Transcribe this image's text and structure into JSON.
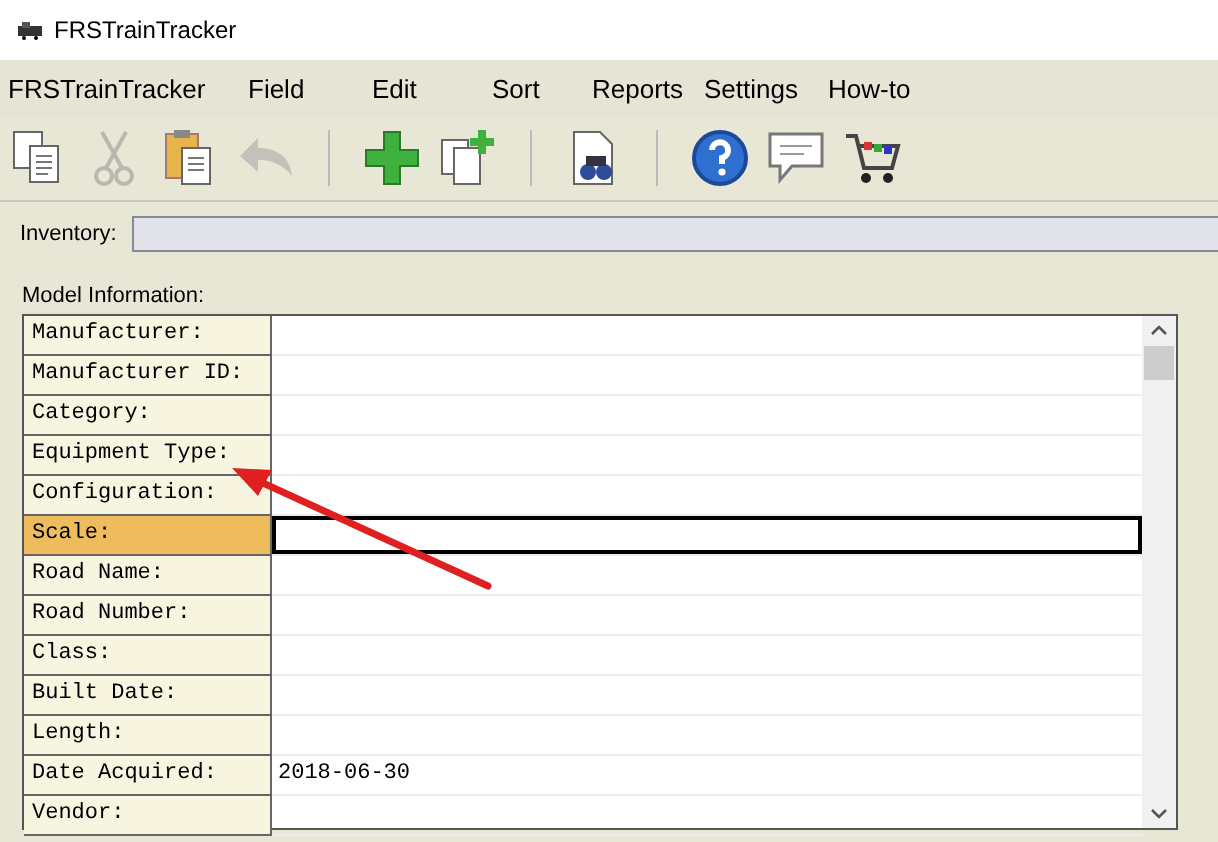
{
  "window": {
    "title": "FRSTrainTracker"
  },
  "menu": [
    "FRSTrainTracker",
    "Field",
    "Edit",
    "Sort",
    "Reports",
    "Settings",
    "How-to"
  ],
  "toolbar": [
    {
      "kind": "copy",
      "disabled": false
    },
    {
      "kind": "cut",
      "disabled": true
    },
    {
      "kind": "paste",
      "disabled": false
    },
    {
      "kind": "undo",
      "disabled": true
    },
    {
      "kind": "sep"
    },
    {
      "kind": "add",
      "disabled": false
    },
    {
      "kind": "duplicate",
      "disabled": false
    },
    {
      "kind": "sep"
    },
    {
      "kind": "find",
      "disabled": false
    },
    {
      "kind": "sep"
    },
    {
      "kind": "help",
      "disabled": false
    },
    {
      "kind": "chat",
      "disabled": false
    },
    {
      "kind": "cart",
      "disabled": false
    }
  ],
  "inventory": {
    "label": "Inventory:"
  },
  "model_info": {
    "label": "Model Information:",
    "rows": [
      {
        "label": "Manufacturer:",
        "selected": false
      },
      {
        "label": "Manufacturer ID:",
        "selected": false
      },
      {
        "label": "Category:",
        "selected": false
      },
      {
        "label": "Equipment Type:",
        "selected": false
      },
      {
        "label": "Configuration:",
        "selected": false
      },
      {
        "label": "Scale:",
        "selected": true
      },
      {
        "label": "Road Name:",
        "selected": false
      },
      {
        "label": "Road Number:",
        "selected": false
      },
      {
        "label": "Class:",
        "selected": false
      },
      {
        "label": "Built Date:",
        "selected": false
      },
      {
        "label": "Length:",
        "selected": false
      },
      {
        "label": "Date Acquired:",
        "selected": false,
        "value": "2018-06-30"
      },
      {
        "label": "Vendor:",
        "selected": false
      }
    ]
  }
}
